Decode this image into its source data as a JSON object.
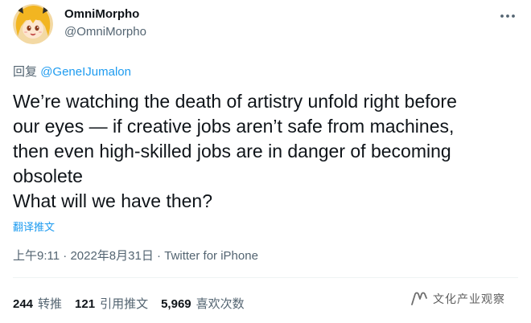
{
  "author": {
    "display_name": "OmniMorpho",
    "handle": "@OmniMorpho"
  },
  "reply": {
    "prefix": "回复",
    "mention": "@GeneIJumalon"
  },
  "tweet": {
    "lines": [
      "We’re watching the death of artistry unfold right before",
      "our eyes — if creative jobs aren’t safe from machines,",
      "then even high-skilled jobs are in danger of becoming",
      "obsolete",
      "What will we have then?"
    ],
    "translate_label": "翻译推文"
  },
  "meta": {
    "time": "上午9:11",
    "sep1": " · ",
    "date": "2022年8月31日",
    "sep2": " · ",
    "source": "Twitter for iPhone"
  },
  "stats": [
    {
      "count": "244",
      "label": "转推"
    },
    {
      "count": "121",
      "label": "引用推文"
    },
    {
      "count": "5,969",
      "label": "喜欢次数"
    }
  ],
  "watermark": {
    "text": "文化产业观察",
    "icon": "wechat-channel-icon"
  },
  "icons": {
    "more": "more-options-icon",
    "avatar": "anime-girl-avatar"
  },
  "colors": {
    "link": "#1d9bf0",
    "secondary_text": "#536471",
    "primary_text": "#0f1419",
    "divider": "#eff3f4"
  }
}
